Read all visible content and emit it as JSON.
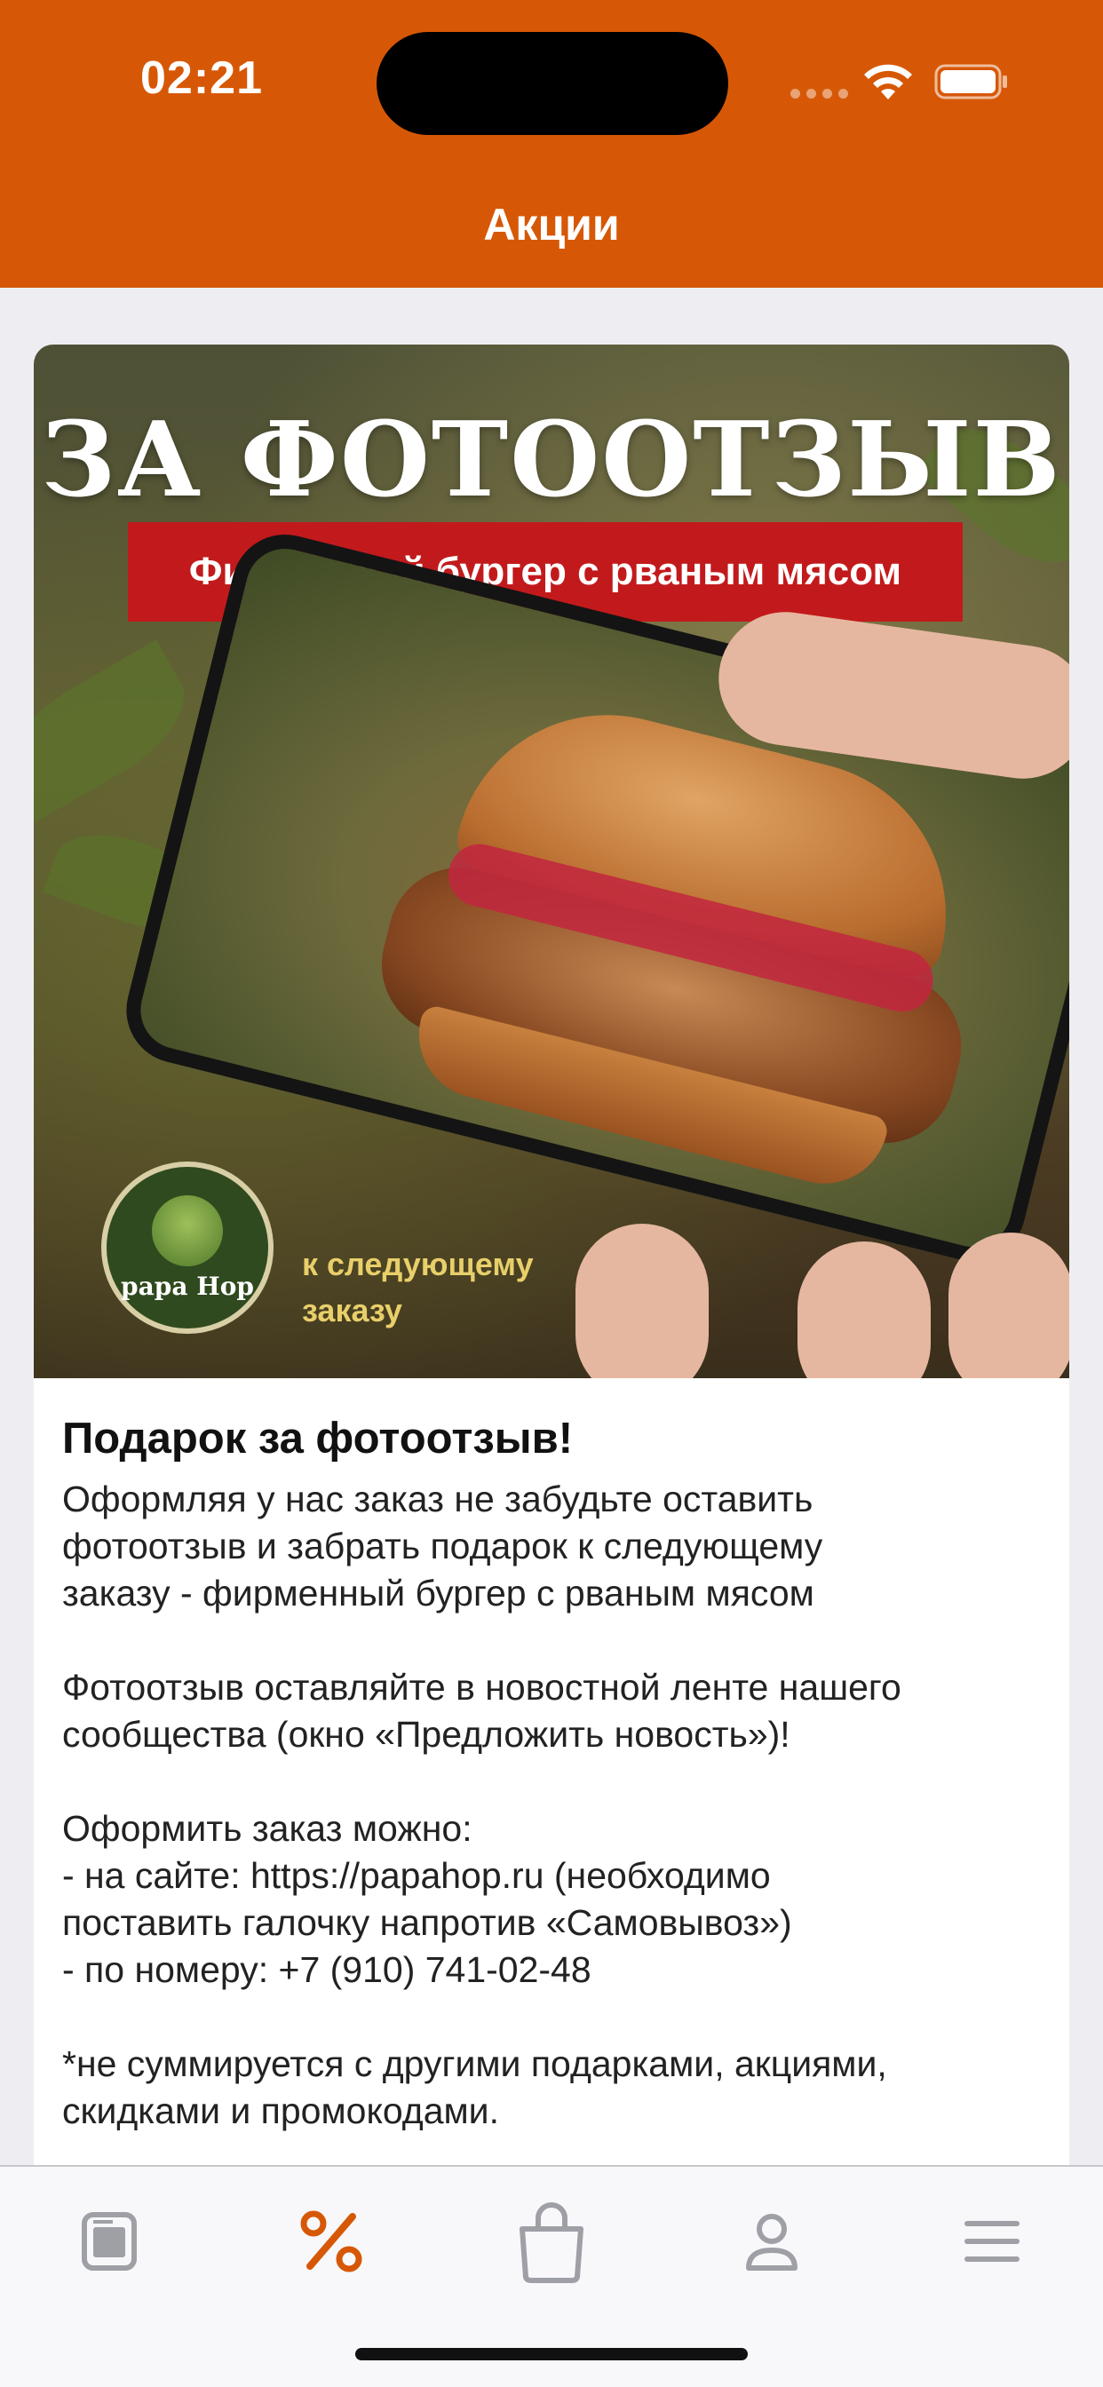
{
  "status_bar": {
    "time": "02:21"
  },
  "header": {
    "title": "Акции",
    "background_color": "#d65806"
  },
  "banner": {
    "headline": "ЗА ФОТООТЗЫВ",
    "ribbon": "Фирменный бургер с рваным мясом",
    "logo_text": "papa Hop",
    "footnote_line1": "к следующему",
    "footnote_line2": "заказу"
  },
  "promo": {
    "title": "Подарок за фотоотзыв!",
    "p1_l1": "Оформляя у нас заказ не забудьте оставить",
    "p1_l2": "фотоотзыв и забрать подарок к следующему",
    "p1_l3": "заказу - фирменный бургер с рваным мясом",
    "p2_l1": "Фотоотзыв оставляйте в новостной ленте нашего",
    "p2_l2": "сообщества (окно «Предложить новость»)!",
    "p3_l1": "Оформить заказ можно:",
    "p3_l2": "- на сайте: https://papahop.ru (необходимо",
    "p3_l3": "поставить галочку напротив «Самовывоз»)",
    "p3_l4": "- по номеру: +7 (910) 741-02-48",
    "p4_l1": "*не суммируется с другими подарками, акциями,",
    "p4_l2": "скидками и промокодами."
  },
  "tabbar": {
    "active_color": "#d65806",
    "inactive_color": "#9ea0a6",
    "tabs": [
      {
        "icon": "menu-card-icon",
        "active": false
      },
      {
        "icon": "percent-icon",
        "active": true
      },
      {
        "icon": "shopping-bag-icon",
        "active": false
      },
      {
        "icon": "profile-icon",
        "active": false
      },
      {
        "icon": "hamburger-menu-icon",
        "active": false
      }
    ]
  }
}
